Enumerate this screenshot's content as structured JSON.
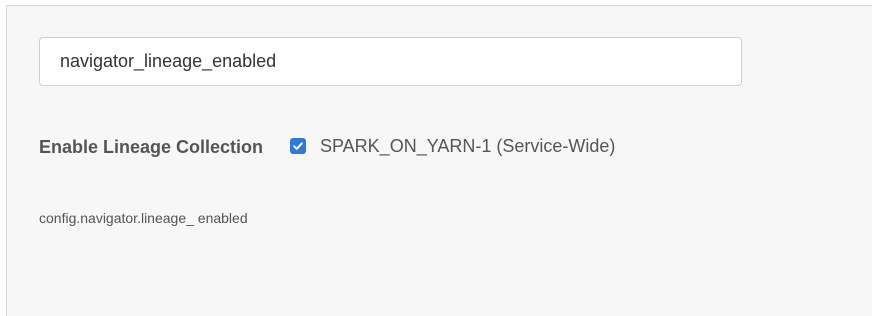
{
  "search": {
    "value": "navigator_lineage_enabled"
  },
  "property": {
    "display_name": "Enable Lineage Collection",
    "config_key": "config.navigator.lineage_ enabled",
    "scope_label": "SPARK_ON_YARN-1 (Service-Wide)",
    "checked": true
  },
  "colors": {
    "checkbox_accent": "#2d7bd6",
    "panel_background": "#f7f7f7"
  }
}
